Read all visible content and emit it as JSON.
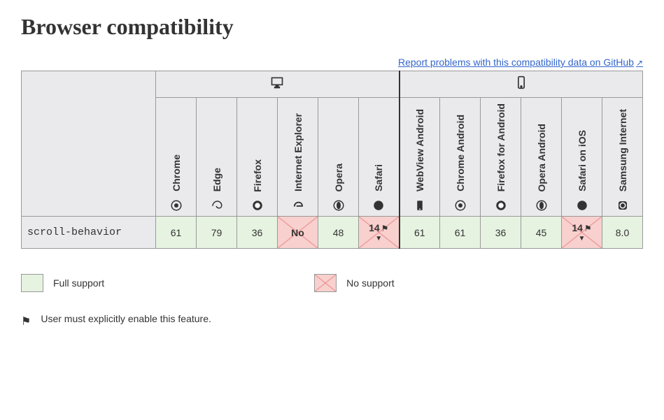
{
  "title": "Browser compatibility",
  "report_link": "Report problems with this compatibility data on GitHub",
  "platforms": {
    "desktop": "desktop",
    "mobile": "mobile"
  },
  "browsers": [
    {
      "name": "Chrome",
      "platform": "desktop"
    },
    {
      "name": "Edge",
      "platform": "desktop"
    },
    {
      "name": "Firefox",
      "platform": "desktop"
    },
    {
      "name": "Internet Explorer",
      "platform": "desktop"
    },
    {
      "name": "Opera",
      "platform": "desktop"
    },
    {
      "name": "Safari",
      "platform": "desktop"
    },
    {
      "name": "WebView Android",
      "platform": "mobile"
    },
    {
      "name": "Chrome Android",
      "platform": "mobile"
    },
    {
      "name": "Firefox for Android",
      "platform": "mobile"
    },
    {
      "name": "Opera Android",
      "platform": "mobile"
    },
    {
      "name": "Safari on iOS",
      "platform": "mobile"
    },
    {
      "name": "Samsung Internet",
      "platform": "mobile"
    }
  ],
  "feature": "scroll-behavior",
  "values": [
    {
      "text": "61",
      "support": "yes"
    },
    {
      "text": "79",
      "support": "yes"
    },
    {
      "text": "36",
      "support": "yes"
    },
    {
      "text": "No",
      "support": "no",
      "bold": true
    },
    {
      "text": "48",
      "support": "yes"
    },
    {
      "text": "14",
      "support": "no",
      "bold": true,
      "flag": true,
      "carrot": true
    },
    {
      "text": "61",
      "support": "yes"
    },
    {
      "text": "61",
      "support": "yes"
    },
    {
      "text": "36",
      "support": "yes"
    },
    {
      "text": "45",
      "support": "yes"
    },
    {
      "text": "14",
      "support": "no",
      "bold": true,
      "flag": true,
      "carrot": true
    },
    {
      "text": "8.0",
      "support": "yes"
    }
  ],
  "legend": {
    "full": "Full support",
    "no": "No support",
    "flag_note": "User must explicitly enable this feature."
  }
}
